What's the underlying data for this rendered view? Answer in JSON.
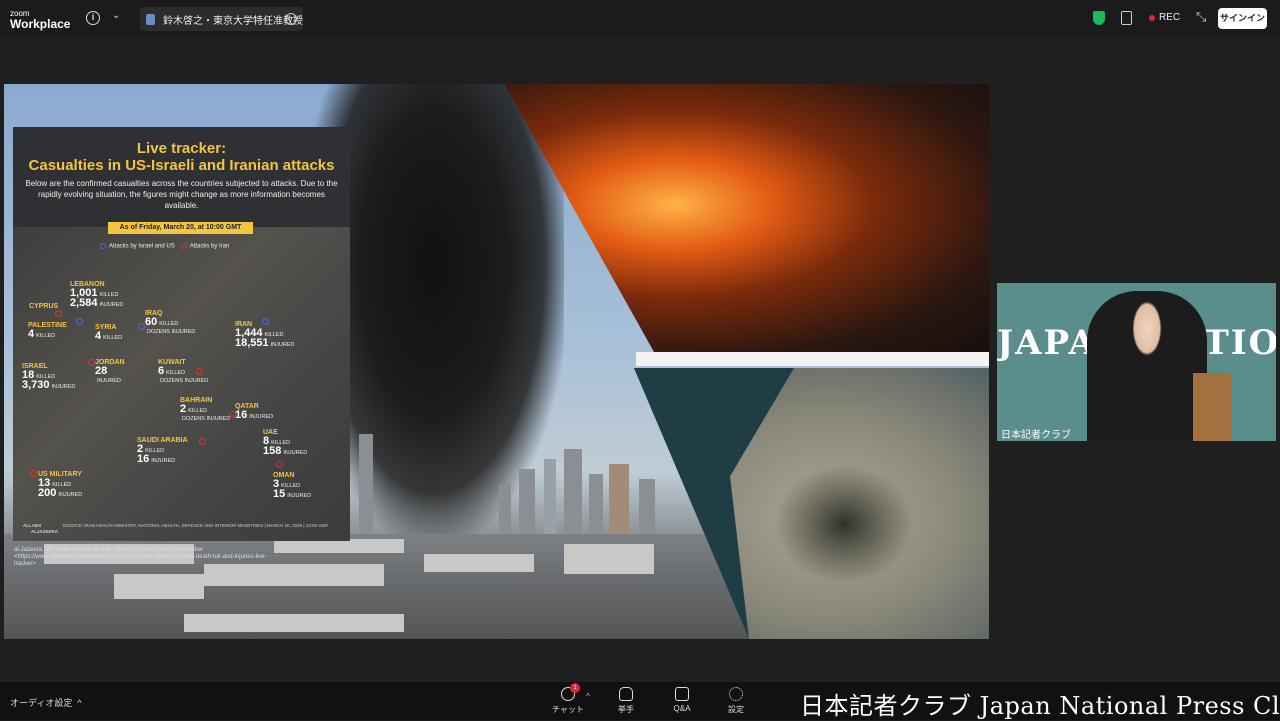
{
  "app": {
    "logo_line1": "zoom",
    "logo_line2": "Workplace"
  },
  "meeting": {
    "title": "鈴木啓之・東京大学特任准教授"
  },
  "topbar": {
    "rec_label": "REC",
    "signin_label": "サインイン"
  },
  "tracker": {
    "title_line1": "Live tracker:",
    "title_line2": "Casualties in US-Israeli and Iranian attacks",
    "description": "Below are the confirmed casualties across the countries subjected to attacks. Due to the rapidly evolving situation, the figures might change as more information becomes available.",
    "date": "As of Friday, March 20, at 10:00 GMT",
    "legend_blue": "Attacks by Israel and US",
    "legend_red": "Attacks by Iran",
    "countries": {
      "lebanon": {
        "name": "LEBANON",
        "killed": "1,001",
        "injured": "2,584",
        "killed_label": "KILLED",
        "injured_label": "INJURED"
      },
      "cyprus": {
        "name": "CYPRUS"
      },
      "palestine": {
        "name": "PALESTINE",
        "killed": "4",
        "killed_label": "KILLED"
      },
      "syria": {
        "name": "SYRIA",
        "killed": "4",
        "killed_label": "KILLED"
      },
      "iraq": {
        "name": "IRAQ",
        "killed": "60",
        "killed_label": "KILLED",
        "note": "DOZENS INJURED"
      },
      "iran": {
        "name": "IRAN",
        "killed": "1,444",
        "injured": "18,551",
        "killed_label": "KILLED",
        "injured_label": "INJURED"
      },
      "israel": {
        "name": "ISRAEL",
        "killed": "18",
        "injured": "3,730",
        "killed_label": "KILLED",
        "injured_label": "INJURED"
      },
      "jordan": {
        "name": "JORDAN",
        "injured": "28",
        "injured_label": "INJURED"
      },
      "kuwait": {
        "name": "KUWAIT",
        "killed": "6",
        "killed_label": "KILLED",
        "note": "DOZENS INJURED"
      },
      "bahrain": {
        "name": "BAHRAIN",
        "killed": "2",
        "killed_label": "KILLED",
        "note": "DOZENS INJURED"
      },
      "qatar": {
        "name": "QATAR",
        "injured": "16",
        "injured_label": "INJURED"
      },
      "uae": {
        "name": "UAE",
        "killed": "8",
        "injured": "158",
        "killed_label": "KILLED",
        "injured_label": "INJURED"
      },
      "saudi": {
        "name": "SAUDI ARABIA",
        "killed": "2",
        "injured": "16",
        "killed_label": "KILLED",
        "injured_label": "INJURED"
      },
      "oman": {
        "name": "OMAN",
        "killed": "3",
        "injured": "15",
        "killed_label": "KILLED",
        "injured_label": "INJURED"
      },
      "usmil": {
        "name": "US MILITARY",
        "killed": "13",
        "injured": "200",
        "killed_label": "KILLED",
        "injured_label": "INJURED"
      }
    },
    "footer": "SOURCE: IRAN HEALTH MINISTRY, NATIONAL HEALTH, DEFENCE AND INTERIOR MINISTRIES | MARCH 20, 2026 | 10:00 GMT",
    "brand_left": "ALLABS",
    "brand_right": "ALJAZEERA"
  },
  "citation": "al-Jazeera, US-Israel attacks on Iran: Death toll and injuries live tracker <https://www.aljazeera.com/news/2026/3/1/us-israel-attacks-on-iran-death-toll-and-injuries-live-tracker>",
  "speaker": {
    "banner": "JAPAN NATIONAL",
    "name": "日本記者クラブ"
  },
  "bottombar": {
    "audio_label": "オーディオ設定",
    "chat_label": "チャット",
    "chat_badge": "1",
    "raise_hand_label": "挙手",
    "qa_label": "Q&A",
    "settings_label": "設定",
    "jnpc_banner": "日本記者クラブ Japan National Press Club"
  }
}
